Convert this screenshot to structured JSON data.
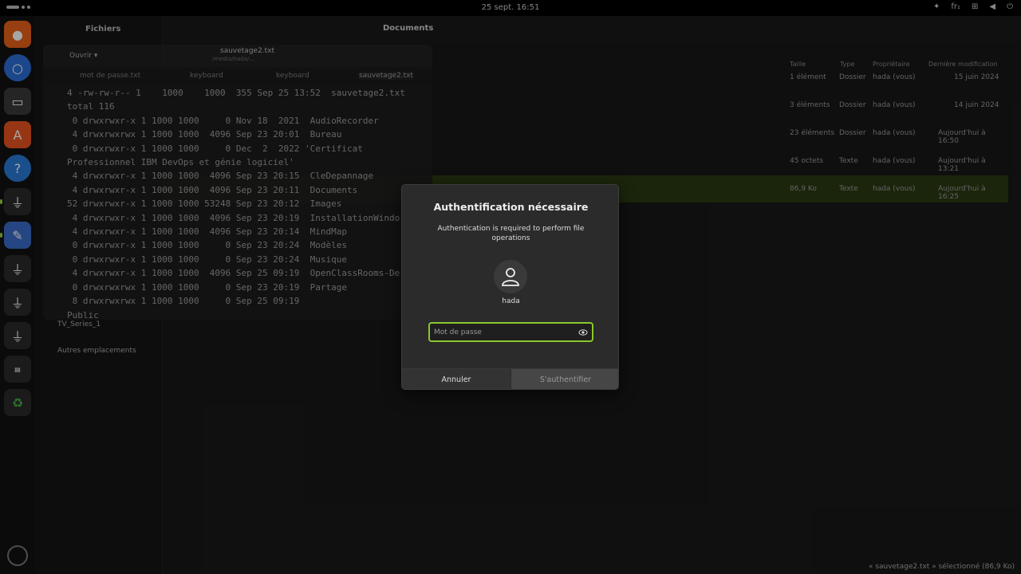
{
  "topbar": {
    "clock": "25 sept.  16:51",
    "lang": "fr₁"
  },
  "files": {
    "sidebar_title": "Fichiers",
    "location": "Documents",
    "sidebar_bottom": [
      "TV_Series_1",
      "Autres emplacements"
    ],
    "columns": [
      "Taille",
      "Type",
      "Propriétaire",
      "Dernière modification"
    ],
    "rows": [
      {
        "size": "1 élément",
        "type": "Dossier",
        "owner": "hada (vous)",
        "modified": "15 juin 2024"
      },
      {
        "size": "3 éléments",
        "type": "Dossier",
        "owner": "hada (vous)",
        "modified": "14 juin 2024"
      },
      {
        "size": "23 éléments",
        "type": "Dossier",
        "owner": "hada (vous)",
        "modified": "Aujourd'hui à 16:50"
      },
      {
        "size": "45 octets",
        "type": "Texte",
        "owner": "hada (vous)",
        "modified": "Aujourd'hui à 13:21"
      },
      {
        "size": "86,9 Ko",
        "type": "Texte",
        "owner": "hada (vous)",
        "modified": "Aujourd'hui à 16:25"
      }
    ],
    "status": "« sauvetage2.txt » sélectionné (86,9 Ko)"
  },
  "editor": {
    "title": "sauvetage2.txt",
    "subtitle": "/media/hada/...",
    "open_label": "Ouvrir",
    "tabs": [
      "mot de passe.txt",
      "keyboard",
      "keyboard",
      "sauvetage2.txt"
    ],
    "lines": [
      "4 -rw-rw-r-- 1    1000    1000  355 Sep 25 13:52  sauvetage2.txt",
      "total 116",
      " 0 drwxrwxr-x 1 1000 1000     0 Nov 18  2021  AudioRecorder",
      " 4 drwxrwxrwx 1 1000 1000  4096 Sep 23 20:01  Bureau",
      " 0 drwxrwxr-x 1 1000 1000     0 Dec  2  2022 'Certificat",
      "Professionnel IBM DevOps et génie logiciel'",
      " 4 drwxrwxr-x 1 1000 1000  4096 Sep 23 20:15  CleDepannage",
      " 4 drwxrwxr-x 1 1000 1000  4096 Sep 23 20:11  Documents",
      "52 drwxrwxr-x 1 1000 1000 53248 Sep 23 20:12  Images",
      " 4 drwxrwxr-x 1 1000 1000  4096 Sep 23 20:19  InstallationWindo",
      " 4 drwxrwxr-x 1 1000 1000  4096 Sep 23 20:14  MindMap",
      " 0 drwxrwxr-x 1 1000 1000     0 Sep 23 20:24  Modèles",
      " 0 drwxrwxr-x 1 1000 1000     0 Sep 23 20:24  Musique",
      " 4 drwxrwxr-x 1 1000 1000  4096 Sep 25 09:19  OpenClassRooms-De",
      " 0 drwxrwxrwx 1 1000 1000     0 Sep 23 20:19  Partage",
      " 8 drwxrwxrwx 1 1000 1000     0 Sep 25 09:19",
      "Public"
    ]
  },
  "dialog": {
    "title": "Authentification nécessaire",
    "message": "Authentication is required to perform file operations",
    "username": "hada",
    "password_placeholder": "Mot de passe",
    "cancel": "Annuler",
    "authenticate": "S'authentifier"
  },
  "colors": {
    "accent": "#8ac82c",
    "selection": "#2a3a12"
  }
}
